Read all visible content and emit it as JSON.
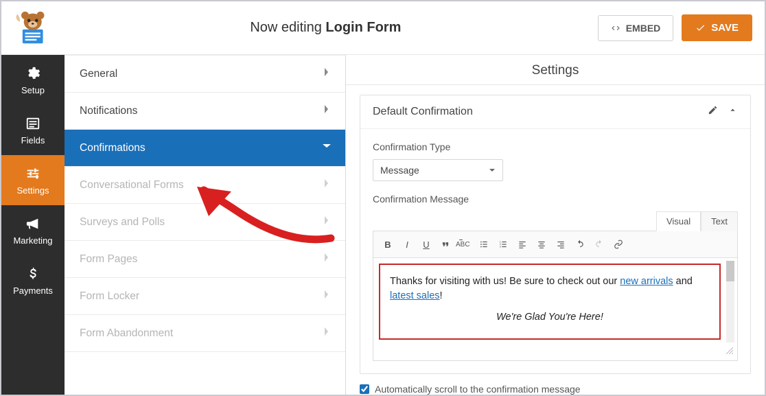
{
  "header": {
    "prefix": "Now editing ",
    "form_name": "Login Form",
    "embed_label": "EMBED",
    "save_label": "SAVE"
  },
  "vsidebar": {
    "items": [
      {
        "label": "Setup"
      },
      {
        "label": "Fields"
      },
      {
        "label": "Settings"
      },
      {
        "label": "Marketing"
      },
      {
        "label": "Payments"
      }
    ]
  },
  "subpanel": {
    "items": [
      {
        "label": "General"
      },
      {
        "label": "Notifications"
      },
      {
        "label": "Confirmations"
      },
      {
        "label": "Conversational Forms"
      },
      {
        "label": "Surveys and Polls"
      },
      {
        "label": "Form Pages"
      },
      {
        "label": "Form Locker"
      },
      {
        "label": "Form Abandonment"
      }
    ]
  },
  "main": {
    "heading": "Settings",
    "card_title": "Default Confirmation",
    "type_label": "Confirmation Type",
    "type_value": "Message",
    "msg_label": "Confirmation Message",
    "tabs": {
      "visual": "Visual",
      "text": "Text"
    },
    "msg_line1a": "Thanks for visiting with us! Be sure to check out our ",
    "msg_link1": "new arrivals",
    "msg_line1b": " and",
    "msg_link2": " latest sales",
    "msg_line1c": "!",
    "msg_line2": "We're Glad You're Here!",
    "autoscroll_label": "Automatically scroll to the confirmation message"
  },
  "colors": {
    "accent": "#e37a1e",
    "active_nav": "#1a6fb9"
  }
}
